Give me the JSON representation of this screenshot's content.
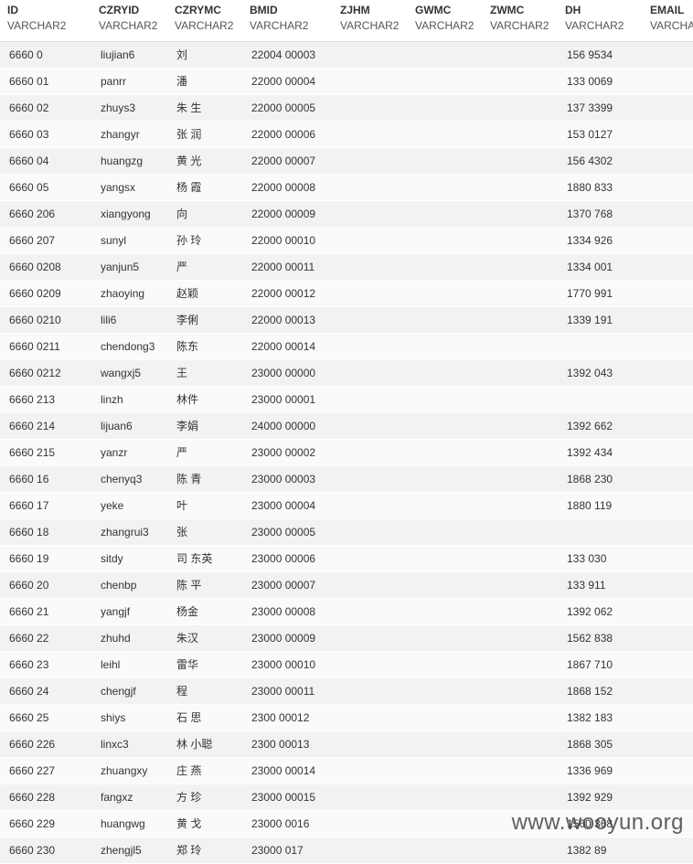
{
  "columns": [
    {
      "name": "ID",
      "type": "VARCHAR2"
    },
    {
      "name": "CZRYID",
      "type": "VARCHAR2"
    },
    {
      "name": "CZRYMC",
      "type": "VARCHAR2"
    },
    {
      "name": "BMID",
      "type": "VARCHAR2"
    },
    {
      "name": "ZJHM",
      "type": "VARCHAR2"
    },
    {
      "name": "GWMC",
      "type": "VARCHAR2"
    },
    {
      "name": "ZWMC",
      "type": "VARCHAR2"
    },
    {
      "name": "DH",
      "type": "VARCHAR2"
    },
    {
      "name": "EMAIL",
      "type": "VARCHA"
    }
  ],
  "rows": [
    [
      "6660    0",
      "liujian6",
      "刘",
      "22004   00003",
      "",
      "",
      "",
      "156    9534",
      ""
    ],
    [
      "6660    01",
      "panrr",
      "潘",
      "22000   00004",
      "",
      "",
      "",
      "133    0069",
      ""
    ],
    [
      "6660    02",
      "zhuys3",
      "朱   生",
      "22000   00005",
      "",
      "",
      "",
      "137    3399",
      ""
    ],
    [
      "6660    03",
      "zhangyr",
      "张  润",
      "22000   00006",
      "",
      "",
      "",
      "153    0127",
      ""
    ],
    [
      "6660    04",
      "huangzg",
      "黄  光",
      "22000   00007",
      "",
      "",
      "",
      "156    4302",
      ""
    ],
    [
      "6660    05",
      "yangsx",
      "杨  霞",
      "22000   00008",
      "",
      "",
      "",
      "1880    833",
      ""
    ],
    [
      "6660    206",
      "xiangyong",
      "向",
      "22000   00009",
      "",
      "",
      "",
      "1370    768",
      ""
    ],
    [
      "6660    207",
      "sunyl",
      "孙  玲",
      "22000   00010",
      "",
      "",
      "",
      "1334    926",
      ""
    ],
    [
      "6660    0208",
      "yanjun5",
      "严",
      "22000   00011",
      "",
      "",
      "",
      "1334    001",
      ""
    ],
    [
      "6660    0209",
      "zhaoying",
      "赵颖",
      "22000   00012",
      "",
      "",
      "",
      "1770    991",
      ""
    ],
    [
      "6660    0210",
      "lili6",
      "李俐",
      "22000   00013",
      "",
      "",
      "",
      "1339    191",
      ""
    ],
    [
      "6660    0211",
      "chendong3",
      "陈东",
      "22000   00014",
      "",
      "",
      "",
      "",
      ""
    ],
    [
      "6660    0212",
      "wangxj5",
      "王",
      "23000   00000",
      "",
      "",
      "",
      "1392    043",
      ""
    ],
    [
      "6660    213",
      "linzh",
      "林件",
      "23000   00001",
      "",
      "",
      "",
      "",
      ""
    ],
    [
      "6660    214",
      "lijuan6",
      "李娟",
      "24000   00000",
      "",
      "",
      "",
      "1392    662",
      ""
    ],
    [
      "6660    215",
      "yanzr",
      "严",
      "23000   00002",
      "",
      "",
      "",
      "1392    434",
      ""
    ],
    [
      "6660    16",
      "chenyq3",
      "陈  青",
      "23000   00003",
      "",
      "",
      "",
      "1868    230",
      ""
    ],
    [
      "6660    17",
      "yeke",
      "叶",
      "23000   00004",
      "",
      "",
      "",
      "1880    119",
      ""
    ],
    [
      "6660    18",
      "zhangrui3",
      "张",
      "23000   00005",
      "",
      "",
      "",
      "",
      ""
    ],
    [
      "6660    19",
      "sitdy",
      "司  东英",
      "23000   00006",
      "",
      "",
      "",
      "133    030",
      ""
    ],
    [
      "6660    20",
      "chenbp",
      "陈  平",
      "23000   00007",
      "",
      "",
      "",
      "133    911",
      ""
    ],
    [
      "6660    21",
      "yangjf",
      "杨金",
      "23000   00008",
      "",
      "",
      "",
      "1392    062",
      ""
    ],
    [
      "6660    22",
      "zhuhd",
      "朱汉",
      "23000   00009",
      "",
      "",
      "",
      "1562    838",
      ""
    ],
    [
      "6660    23",
      "leihl",
      "雷华",
      "23000   00010",
      "",
      "",
      "",
      "1867    710",
      ""
    ],
    [
      "6660    24",
      "chengjf",
      "程",
      "23000   00011",
      "",
      "",
      "",
      "1868    152",
      ""
    ],
    [
      "6660    25",
      "shiys",
      "石  思",
      "2300    00012",
      "",
      "",
      "",
      "1382    183",
      ""
    ],
    [
      "6660    226",
      "linxc3",
      "林  小聪",
      "2300    00013",
      "",
      "",
      "",
      "1868    305",
      ""
    ],
    [
      "6660    227",
      "zhuangxy",
      "庄  燕",
      "23000   00014",
      "",
      "",
      "",
      "1336    969",
      ""
    ],
    [
      "6660    228",
      "fangxz",
      "方  珍",
      "23000   00015",
      "",
      "",
      "",
      "1392    929",
      ""
    ],
    [
      "6660    229",
      "huangwg",
      "黄  戈",
      "23000   0016",
      "",
      "",
      "",
      "1560    368",
      ""
    ],
    [
      "6660    230",
      "zhengjl5",
      "郑  玲",
      "23000   017",
      "",
      "",
      "",
      "1382    89",
      ""
    ]
  ],
  "watermark": "www.wooyun.org"
}
